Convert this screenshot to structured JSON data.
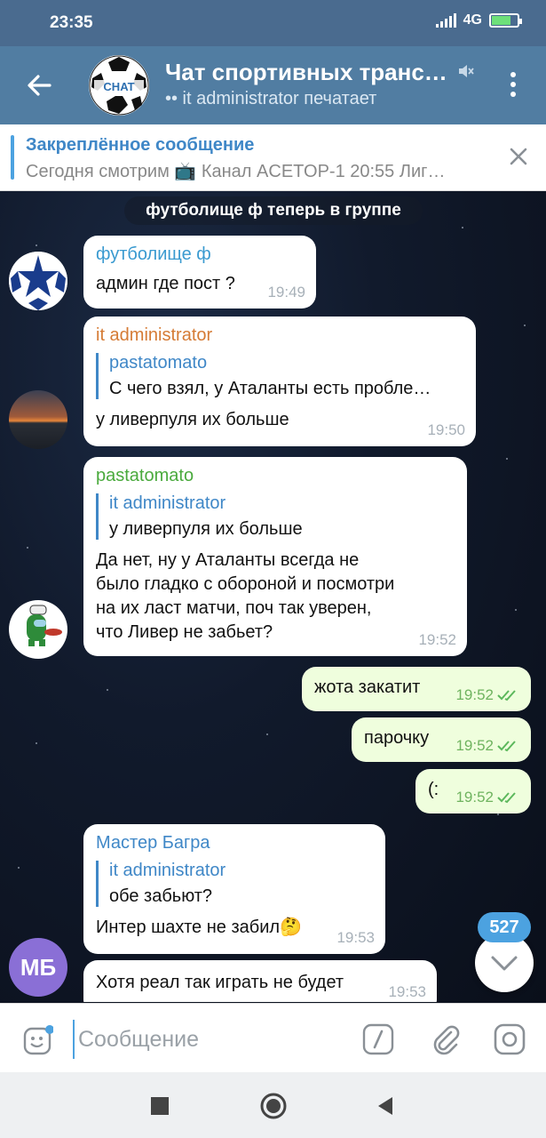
{
  "status": {
    "time": "23:35",
    "network": "4G"
  },
  "header": {
    "title": "Чат спортивных транс…",
    "subtitle": "•• it administrator печатает",
    "avatar_text": "CHAT"
  },
  "pinned": {
    "title": "Закреплённое сообщение",
    "text": "Сегодня смотрим 📺 Канал ACETOP-1 20:55 Лиг…"
  },
  "service_message": "футболище ф теперь в группе",
  "messages": [
    {
      "sender": "футболище ф",
      "text": "админ где пост ?",
      "time": "19:49"
    },
    {
      "sender": "it administrator",
      "reply_name": "pastatomato",
      "reply_text": "С чего взял, у Аталанты есть пробле…",
      "text": "у ливерпуля их больше",
      "time": "19:50"
    },
    {
      "sender": "pastatomato",
      "reply_name": "it administrator",
      "reply_text": "у ливерпуля их больше",
      "text": "Да нет, ну у Аталанты всегда не было гладко с обороной и посмотри на их ласт матчи, поч так уверен, что Ливер не забьет?",
      "time": "19:52"
    },
    {
      "text": "жота закатит",
      "time": "19:52"
    },
    {
      "text": "парочку",
      "time": "19:52"
    },
    {
      "text": "(:",
      "time": "19:52"
    },
    {
      "sender": "Мастер Багра",
      "reply_name": "it administrator",
      "reply_text": "обе забьют?",
      "text": "Интер шахте не забил🤔",
      "time": "19:53"
    },
    {
      "text": "Хотя реал так играть не будет",
      "time": "19:53"
    }
  ],
  "avatars": {
    "master_bagra_initials": "МБ"
  },
  "unread_count": "527",
  "input": {
    "placeholder": "Сообщение"
  },
  "colors": {
    "header": "#517da2",
    "accent": "#4ca2e0",
    "outgoing": "#effedd",
    "name_orange": "#d57b35",
    "name_green": "#4aaa3d",
    "name_blue": "#3f87c7"
  }
}
